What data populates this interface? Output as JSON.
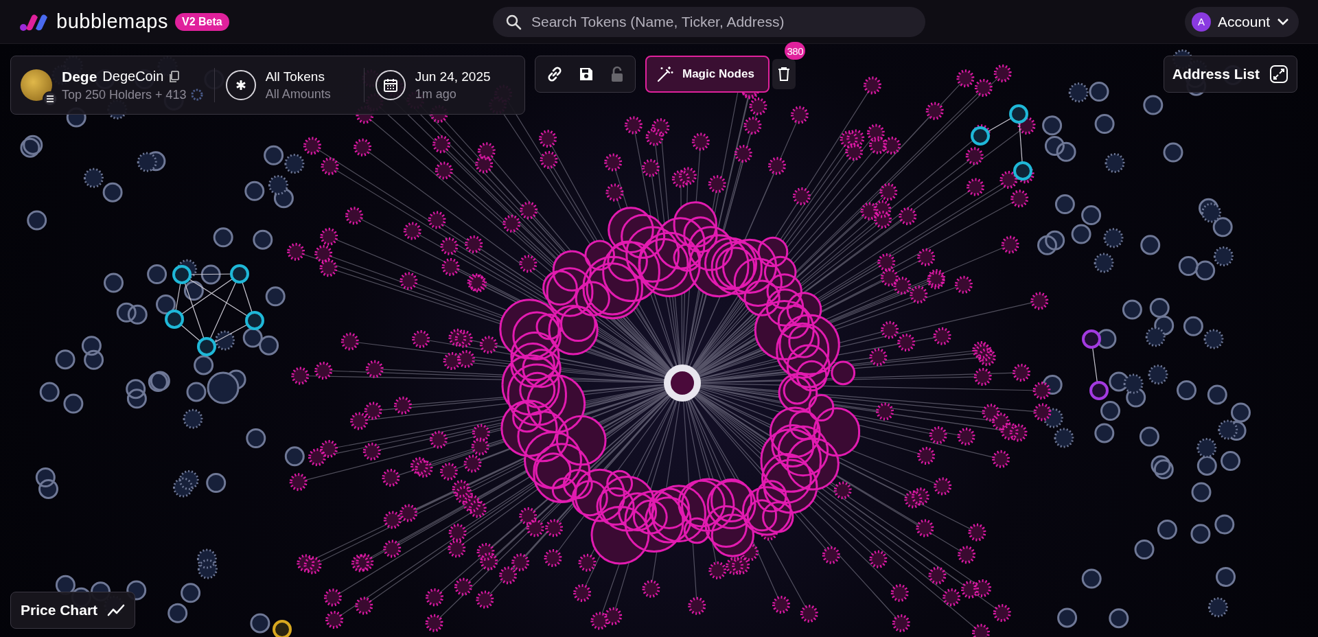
{
  "header": {
    "logo": "bubblemaps",
    "badge": "V2 Beta",
    "search": {
      "placeholder": "Search Tokens (Name, Ticker, Address)"
    },
    "account": {
      "avatar_letter": "A",
      "label": "Account"
    }
  },
  "token_panel": {
    "symbol": "Dege",
    "name": "DegeCoin",
    "holders": "Top 250 Holders + 413",
    "filter": {
      "title": "All Tokens",
      "subtitle": "All Amounts"
    },
    "date": {
      "title": "Jun 24, 2025",
      "subtitle": "1m ago"
    }
  },
  "toolbar": {
    "lock_disabled": true,
    "magic_nodes": {
      "label": "Magic Nodes",
      "active": true,
      "count": "380"
    }
  },
  "address_list": {
    "label": "Address List"
  },
  "price_chart": {
    "label": "Price Chart"
  }
}
